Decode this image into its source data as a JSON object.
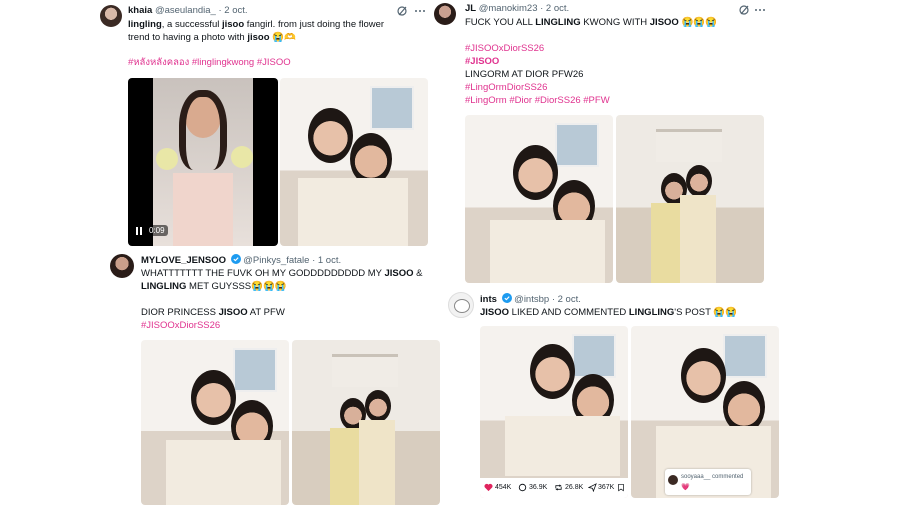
{
  "posts": [
    {
      "name": "khaia",
      "handle": "@aseulandia_",
      "date": "· 2 oct.",
      "text_parts": [
        "lingling",
        ", a successful ",
        "jisoo",
        " fangirl. from just doing the flower"
      ],
      "line2_parts": [
        "trend to having a photo with ",
        "jisoo",
        " 😭🫶"
      ],
      "hashtags": "#หลังหลังคลอง #linglingkwong #JISOO",
      "video_time": "0:09"
    },
    {
      "name": "JL",
      "handle": "@manokim23",
      "date": "· 2 oct.",
      "line1": "FUCK YOU ALL ",
      "line1_b": "LINGLING",
      "line1_c": " KWONG WITH ",
      "line1_d": "JISOO",
      "line1_e": " 😭😭😭",
      "tag1": "#JISOOxDiorSS26",
      "tag2": "#JISOO",
      "line4": "LINGORM AT DIOR PFW26",
      "tag3": "#LingOrmDiorSS26",
      "tag4": "#LingOrm #Dior #DiorSS26 #PFW"
    },
    {
      "name": "MYLOVE_JENSOO",
      "handle": "@Pinkys_fatale",
      "date": "· 1 oct.",
      "line1a": "WHATTTTTTT THE FUVK OH MY GODDDDDDDDD MY ",
      "line1b": "JISOO",
      "line1c": " &",
      "line2a": "LINGLING",
      "line2b": " MET GUYSSS😭😭😭",
      "line3a": "DIOR PRINCESS ",
      "line3b": "JISOO",
      "line3c": " AT PFW",
      "tag": "#JISOOxDiorSS26"
    },
    {
      "name": "ints",
      "handle": "@intsbp",
      "date": "· 2 oct.",
      "line1a": "JISOO",
      "line1b": " LIKED AND COMMENTED ",
      "line1c": "LINGLING",
      "line1d": "'S POST 😭😭",
      "stats": [
        "454K",
        "36.9K",
        "26.8K",
        "367K"
      ],
      "comment_user": "sooyaaa__ commented",
      "comment_text": "💗"
    }
  ],
  "icons": [
    "verified-icon",
    "tweet-more-icon",
    "heart-icon",
    "comment-icon",
    "repost-icon",
    "send-icon",
    "bookmark-icon",
    "pause-icon"
  ],
  "colors": {
    "hashtag": "#e0338f",
    "verified": "#1d9bf0",
    "muted": "#536471"
  }
}
